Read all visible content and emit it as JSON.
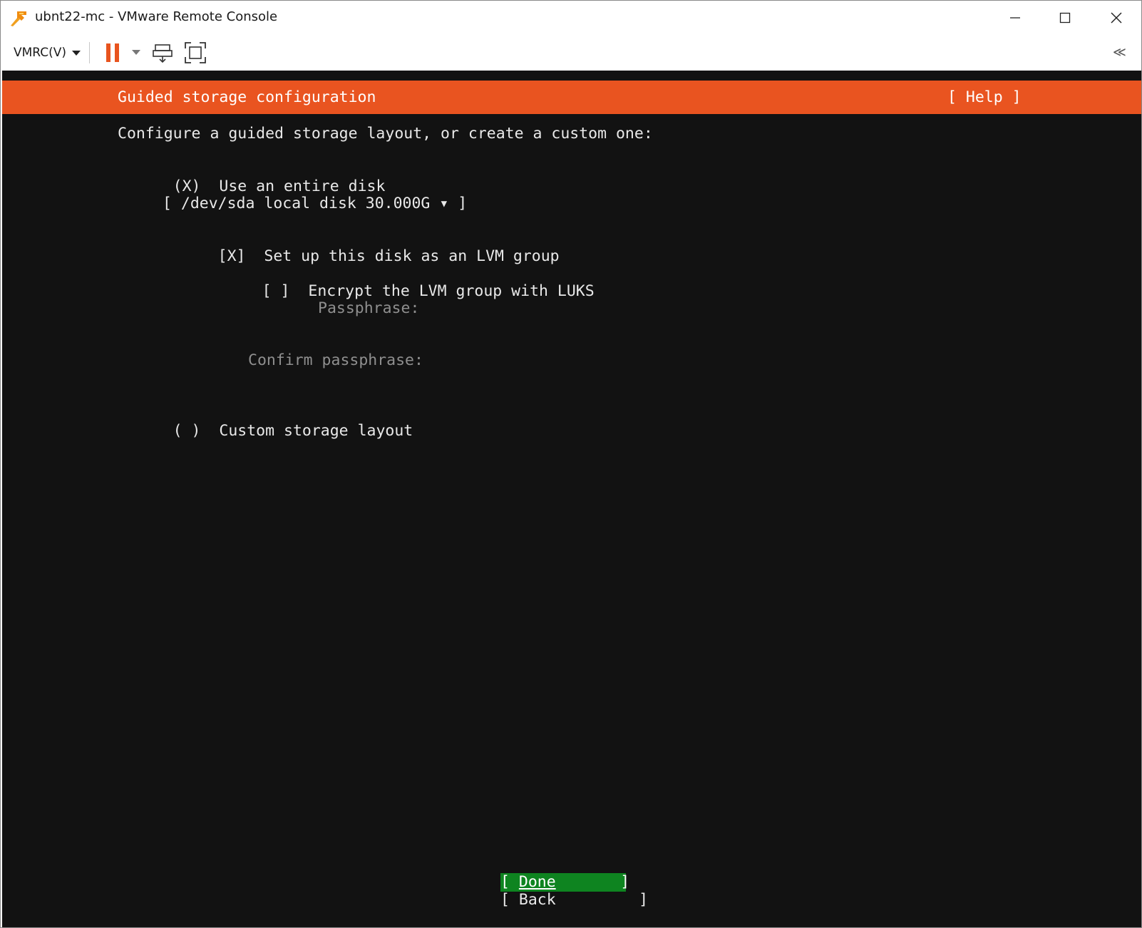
{
  "window": {
    "title": "ubnt22-mc - VMware Remote Console"
  },
  "toolbar": {
    "vmrc_menu_label": "VMRC(V)",
    "collapse_label": "≪"
  },
  "colors": {
    "header_orange": "#e95420",
    "console_bg": "#121212",
    "done_button_green": "#0e8420",
    "pause_orange": "#e8541e"
  },
  "installer": {
    "header_title": "Guided storage configuration",
    "help_label": "[ Help ]",
    "intro": "Configure a guided storage layout, or create a custom one:",
    "options": {
      "entire_disk": {
        "marker": "(X)",
        "label": "Use an entire disk"
      },
      "disk_select": {
        "value": "[ /dev/sda local disk 30.000G ▾ ]"
      },
      "lvm_group": {
        "marker": "[X]",
        "label": "Set up this disk as an LVM group"
      },
      "encrypt_luks": {
        "marker": "[ ]",
        "label": "Encrypt the LVM group with LUKS"
      },
      "passphrase_label": "Passphrase:",
      "confirm_passphrase_label": "Confirm passphrase:",
      "custom_layout": {
        "marker": "( )",
        "label": "Custom storage layout"
      }
    },
    "buttons": {
      "done_open": "[ ",
      "done_label": "Done",
      "done_close": "       ]",
      "back_label": "[ Back         ]"
    }
  }
}
